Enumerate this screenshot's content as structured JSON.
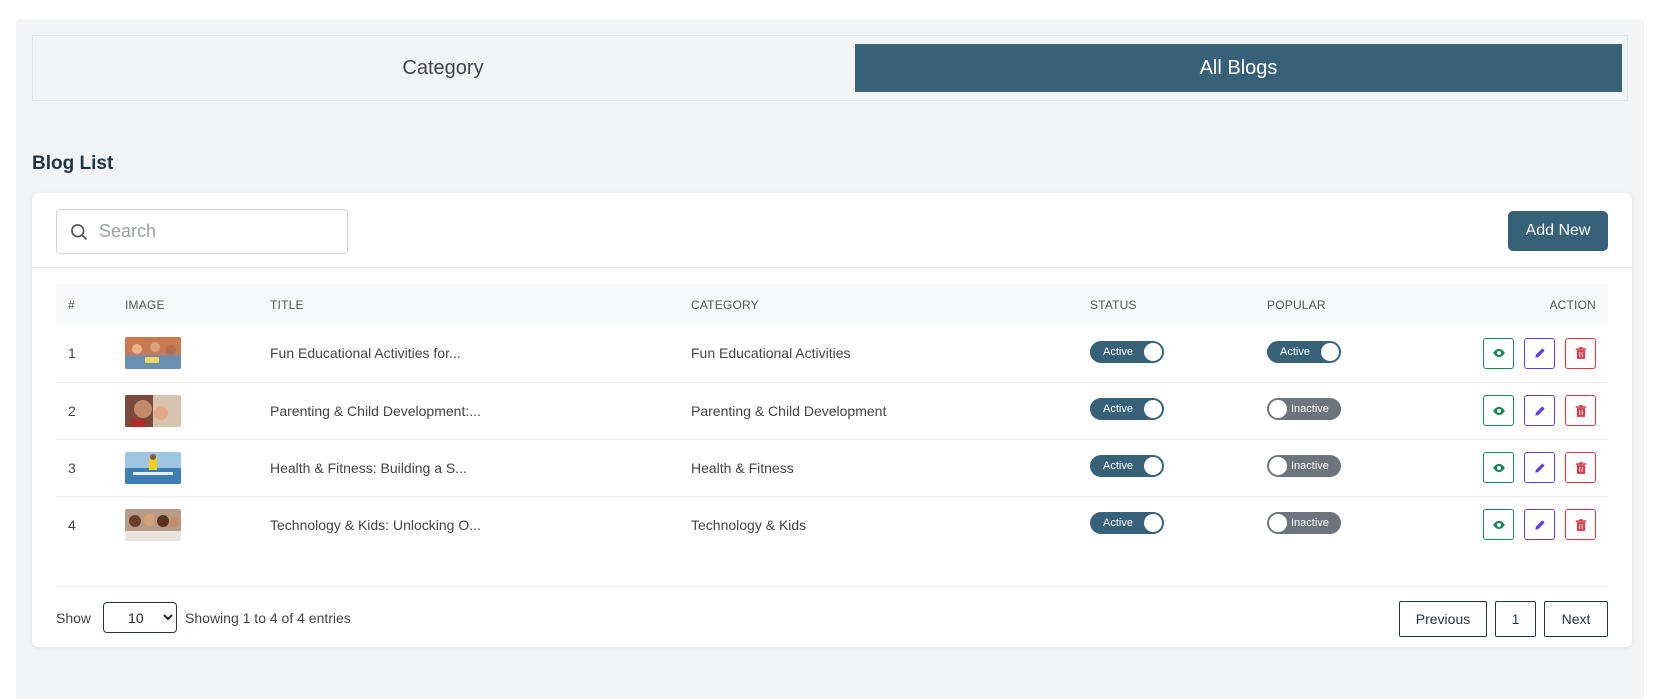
{
  "tabs": [
    {
      "label": "Category"
    },
    {
      "label": "All Blogs"
    }
  ],
  "section_title": "Blog List",
  "search": {
    "placeholder": "Search",
    "value": ""
  },
  "add_button": "Add New",
  "table": {
    "headers": [
      "#",
      "IMAGE",
      "TITLE",
      "CATEGORY",
      "STATUS",
      "POPULAR",
      "ACTION"
    ],
    "rows": [
      {
        "num": "1",
        "title": "Fun Educational Activities for...",
        "category": "Fun Educational Activities",
        "status": "Active",
        "popular": "Active"
      },
      {
        "num": "2",
        "title": "Parenting & Child Development:...",
        "category": "Parenting & Child Development",
        "status": "Active",
        "popular": "Inactive"
      },
      {
        "num": "3",
        "title": "Health & Fitness: Building a S...",
        "category": "Health & Fitness",
        "status": "Active",
        "popular": "Inactive"
      },
      {
        "num": "4",
        "title": "Technology & Kids: Unlocking O...",
        "category": "Technology & Kids",
        "status": "Active",
        "popular": "Inactive"
      }
    ]
  },
  "footer": {
    "show_label": "Show",
    "page_size": "10",
    "entries_text": "Showing 1 to 4 of 4 entries"
  },
  "pagination": {
    "previous": "Previous",
    "current": "1",
    "next": "Next"
  },
  "colors": {
    "primary": "#376079",
    "view": "#198754",
    "edit": "#5a3ff0",
    "delete": "#dc3545"
  }
}
